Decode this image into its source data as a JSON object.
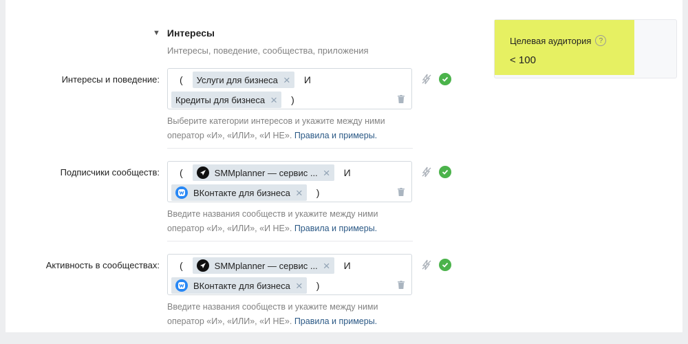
{
  "section": {
    "caret": "▼",
    "title": "Интересы",
    "subtitle": "Интересы, поведение, сообщества, приложения"
  },
  "rows": [
    {
      "label": "Интересы и поведение:",
      "line1": {
        "paren": "(",
        "token": "Услуги для бизнеса",
        "op": "И"
      },
      "line2": {
        "token": "Кредиты для бизнеса",
        "paren": ")"
      },
      "hint": "Выберите категории интересов и укажите между ними оператор «И», «ИЛИ», «И НЕ».",
      "link": "Правила и примеры."
    },
    {
      "label": "Подписчики сообществ:",
      "line1": {
        "paren": "(",
        "token": "SMMplanner — сервис ...",
        "op": "И"
      },
      "line2": {
        "token": "ВКонтакте для бизнеса",
        "paren": ")"
      },
      "hint": "Введите названия сообществ и укажите между ними оператор «И», «ИЛИ», «И НЕ».",
      "link": "Правила и примеры."
    },
    {
      "label": "Активность в сообществах:",
      "line1": {
        "paren": "(",
        "token": "SMMplanner — сервис ...",
        "op": "И"
      },
      "line2": {
        "token": "ВКонтакте для бизнеса",
        "paren": ")"
      },
      "hint": "Введите названия сообществ и укажите между ними оператор «И», «ИЛИ», «И НЕ».",
      "link": "Правила и примеры."
    }
  ],
  "audience": {
    "title": "Целевая аудитория",
    "help": "?",
    "value": "< 100",
    "highlight_color": "#e6f062"
  },
  "icons": {
    "remove": "×",
    "trash": "trash-icon",
    "no_flash": "no-flash-icon",
    "ok": "check-circle-icon",
    "smm_avatar": "smmplanner-logo-icon",
    "vk_avatar": "vk-logo-icon"
  },
  "colors": {
    "link": "#2a5885",
    "ok_green": "#4bb34b",
    "token_bg": "#dee5eb"
  }
}
